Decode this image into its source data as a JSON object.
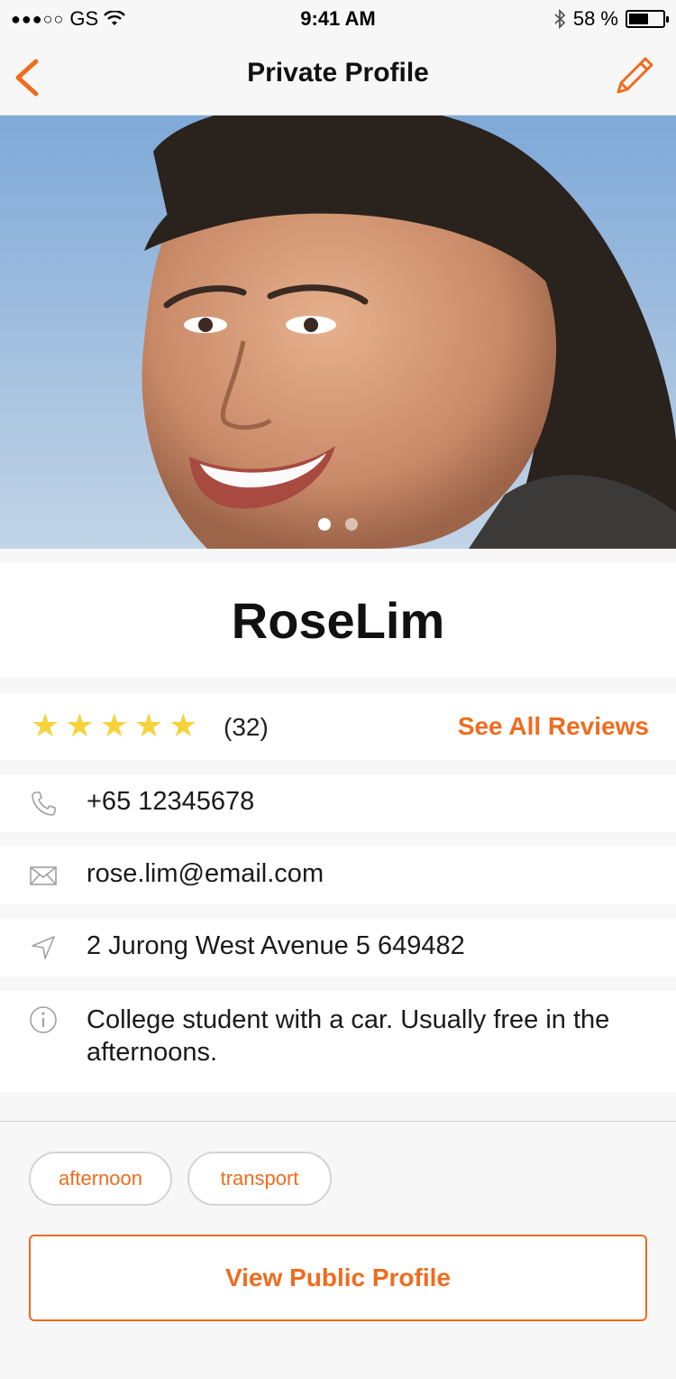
{
  "status_bar": {
    "carrier": "GS",
    "time": "9:41 AM",
    "battery_percent": "58 %",
    "battery_level": 0.58
  },
  "nav": {
    "title": "Private Profile",
    "accent_color": "#ef6c1e"
  },
  "profile": {
    "photo_pages": 2,
    "active_photo": 1,
    "name": "RoseLim",
    "rating_stars": 5,
    "review_count": "(32)",
    "see_all_label": "See All Reviews",
    "phone": "+65 12345678",
    "email": "rose.lim@email.com",
    "address": "2 Jurong West Avenue 5 649482",
    "about": "College student with a car. Usually free in the afternoons.",
    "tags": [
      "afternoon",
      "transport"
    ],
    "public_profile_label": "View Public Profile"
  },
  "icons": {
    "back": "chevron-left-icon",
    "edit": "pencil-icon",
    "phone": "phone-icon",
    "email": "envelope-icon",
    "address": "location-arrow-icon",
    "about": "info-icon"
  }
}
